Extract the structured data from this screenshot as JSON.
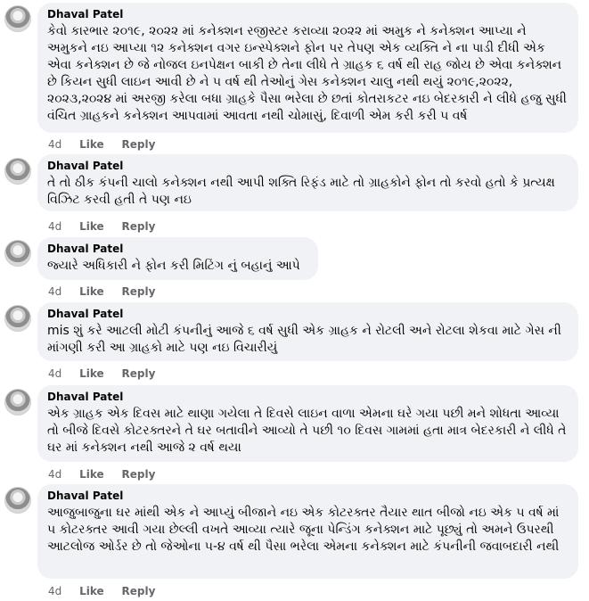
{
  "comments": [
    {
      "author": "Dhaval Patel",
      "text": "કેવો કારભાર ૨૦૧૯, ૨૦૨૨ માં કનેક્શન રજીસ્ટર કરાવ્યા ૨૦૨૨ માં અમુક ને કનેક્શન આપ્યા ને અમુકને નઇ આપ્યા ૧૨ કનેક્શન વગર ઇન્સ્પેક્શને ફોન પર તેપણ એક વ્યક્તિ ને ના પાડી દીધી એક એવા કનેક્શન છે જે નોજલ ઇનપેક્ષન બાકી છે તેના લીધે તે ગ્રાહક ૬ વર્ષ થી રાહ જોય છે એવા કનેક્શન છે કિયન સુધી લાઇન આવી છે ને ૫ વર્ષ થી તેઓનું ગેસ કનેક્શન ચાલુ નથી થયું ૨૦૧૯,૨૦૨૨, ૨૦૨૩,૨૦૨૪ માં અરજી કરેલા બધા ગ્રાહકે પૈસા ભરેલા છે છતાં કોતરાકટર નઇ બેદરકારી ને લીધે હજુ સુધી વંચિત ગ્રાહકને કનેક્શન આપવામાં આવતા નથી ચોમાસું, દિવાળી એમ કરી કરી ૫ વર્ષ",
      "time": "4d",
      "like": "Like",
      "reply": "Reply"
    },
    {
      "author": "Dhaval Patel",
      "text": "તે તો ઠીક કંપની ચાલો કનેક્શન નથી આપી શક્તિ રિફંડ માટે તો ગ્રાહકોને ફોન તો કરવો હતો કે પ્રત્યક્ષ વિઝિટ કરવી હતી તે પણ નઇ",
      "time": "4d",
      "like": "Like",
      "reply": "Reply"
    },
    {
      "author": "Dhaval Patel",
      "text": "જ્યારે અધિકારી ને ફોન કરી મિટિંગ નું બહાનું આપે",
      "time": "4d",
      "like": "Like",
      "reply": "Reply"
    },
    {
      "author": "Dhaval Patel",
      "text": "mis શું કરે આટલી મોટી કંપનીનું આજે ૬ વર્ષ સુધી એક ગ્રાહક ને રોટલી અને રોટલા શેકવા માટે ગેસ ની માંગણી કરી આ ગ્રાહકો માટે પણ નઇ વિચારીયું",
      "time": "4d",
      "like": "Like",
      "reply": "Reply"
    },
    {
      "author": "Dhaval Patel",
      "text": "એક ગ્રાહક એક દિવસ માટે થાણા ગયેલા તે દિવસે લાઇન વાળા એમના ઘરે ગયા પછી મને શોધતા આવ્યા તો બીજે દિવસે કોટરક્તરને તે ઘર બતાવીને આવ્યો તે પછી ૧૦ દિવસ ગામમાં હતા માત્ર બેદરકારી ને લીધે તે ઘર માં કનેક્શન નથી આજે ૨ વર્ષ થયા",
      "time": "4d",
      "like": "Like",
      "reply": "Reply"
    },
    {
      "author": "Dhaval Patel",
      "text": "આજુબાજુના ઘર માંથી એક ને આપ્યું બીજાને નઇ એક કોટરક્તર તૈયાર થાત બીજો નઇ એક ૫ વર્ષ માં ૫ કોટરક્તર આવી ગયા છેલ્લી વખતે આવ્યા ત્યારે જૂના પેન્ડિંગ કનેક્શન માટે પૂછ્યું તો અમને ઉપરથી આટલોજ ઓર્ડર છે તો જેઓના ૫-૪ વર્ષ થી પૈસા ભરેલા એમના કનેક્શન માટે કંપનીની જવાબદારી નથી",
      "time": "4d",
      "like": "Like",
      "reply": "Reply"
    }
  ]
}
